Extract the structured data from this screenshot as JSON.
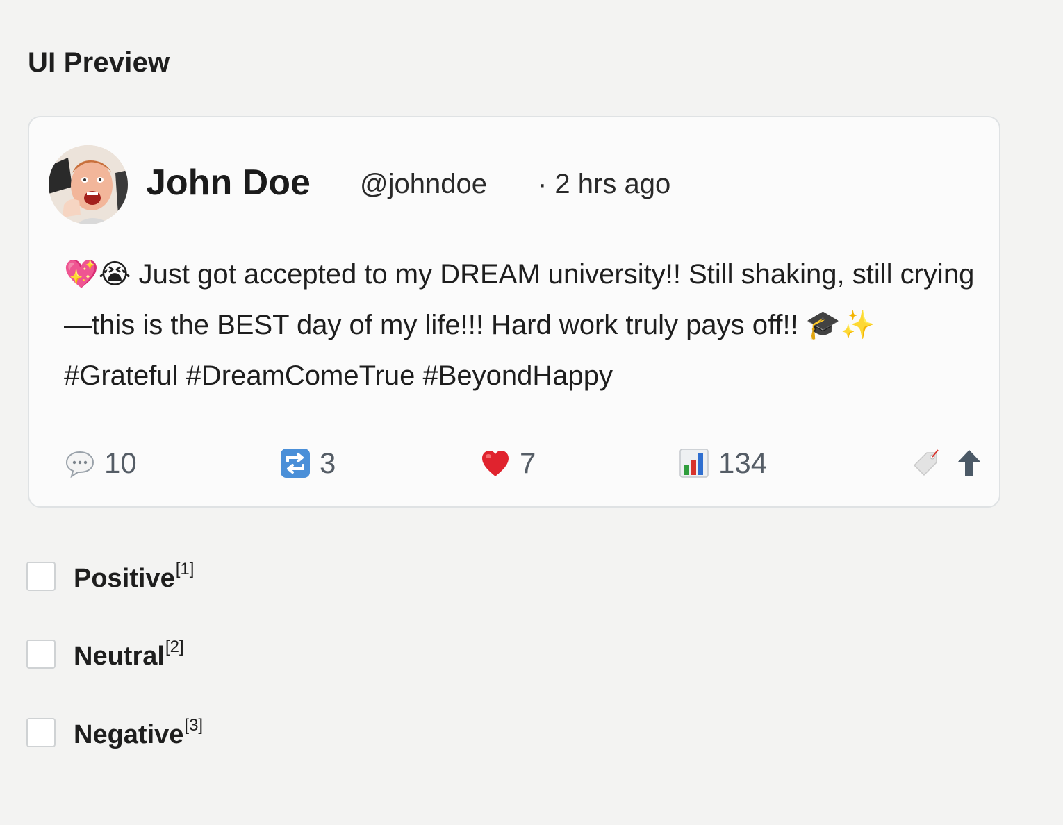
{
  "page": {
    "title": "UI Preview"
  },
  "post": {
    "author_name": "John Doe",
    "handle": "@johndoe",
    "timestamp": "· 2 hrs ago",
    "text": "💖😭 Just got accepted to my DREAM university!! Still shaking, still crying—this is the BEST day of my life!!! Hard work truly pays off!! 🎓✨ #Grateful #DreamComeTrue #BeyondHappy",
    "avatar_icon": "avatar-photo",
    "actions": {
      "replies": "10",
      "reposts": "3",
      "likes": "7",
      "views": "134"
    },
    "icons": {
      "reply": "speech-bubble-icon",
      "repost": "repeat-icon",
      "like": "heart-icon",
      "views": "bar-chart-icon",
      "bookmark": "bookmark-tag-icon",
      "share": "up-arrow-icon"
    }
  },
  "options": [
    {
      "label": "Positive",
      "ref": "[1]",
      "checked": false
    },
    {
      "label": "Neutral",
      "ref": "[2]",
      "checked": false
    },
    {
      "label": "Negative",
      "ref": "[3]",
      "checked": false
    }
  ],
  "colors": {
    "background": "#f3f3f2",
    "card": "#fbfbfb",
    "card_border": "#dfe2e4",
    "like_red": "#e0232e",
    "repost_blue": "#4a8fd8",
    "count_gray": "#555d66"
  }
}
